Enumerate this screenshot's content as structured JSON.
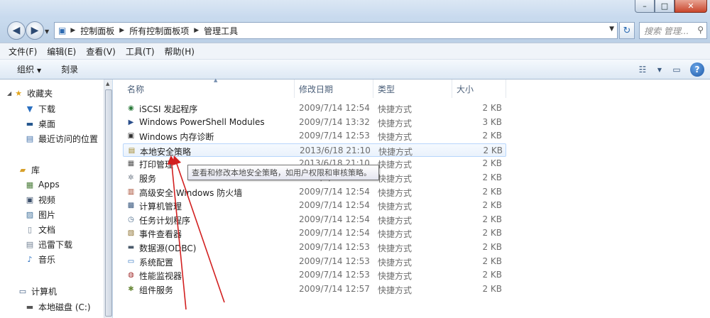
{
  "window": {
    "min_glyph": "–",
    "max_glyph": "□",
    "close_glyph": "✕"
  },
  "address": {
    "segments": [
      "控制面板",
      "所有控制面板项",
      "管理工具"
    ],
    "search_placeholder": "搜索 管理..."
  },
  "menu": [
    "文件(F)",
    "编辑(E)",
    "查看(V)",
    "工具(T)",
    "帮助(H)"
  ],
  "commands": {
    "organize": "组织",
    "burn": "刻录"
  },
  "sidebar": {
    "favorites": {
      "label": "收藏夹",
      "items": [
        "下载",
        "桌面",
        "最近访问的位置"
      ]
    },
    "libraries": {
      "label": "库",
      "items": [
        "Apps",
        "视频",
        "图片",
        "文档",
        "迅雷下载",
        "音乐"
      ]
    },
    "computer": {
      "label": "计算机",
      "items": [
        "本地磁盘 (C:)"
      ]
    }
  },
  "columns": {
    "name": "名称",
    "date": "修改日期",
    "type": "类型",
    "size": "大小"
  },
  "files": [
    {
      "name": "iSCSI 发起程序",
      "date": "2009/7/14 12:54",
      "type": "快捷方式",
      "size": "2 KB",
      "icon": "iscsi-icon"
    },
    {
      "name": "Windows PowerShell Modules",
      "date": "2009/7/14 13:32",
      "type": "快捷方式",
      "size": "3 KB",
      "icon": "powershell-icon"
    },
    {
      "name": "Windows 内存诊断",
      "date": "2009/7/14 12:53",
      "type": "快捷方式",
      "size": "2 KB",
      "icon": "memory-diagnostic-icon"
    },
    {
      "name": "本地安全策略",
      "date": "2013/6/18 21:10",
      "type": "快捷方式",
      "size": "2 KB",
      "icon": "security-policy-icon"
    },
    {
      "name": "打印管理",
      "date": "2013/6/18 21:10",
      "type": "快捷方式",
      "size": "2 KB",
      "icon": "print-management-icon"
    },
    {
      "name": "服务",
      "date": "2009/7/14 12:54",
      "type": "快捷方式",
      "size": "2 KB",
      "icon": "services-icon"
    },
    {
      "name": "高级安全 Windows 防火墙",
      "date": "2009/7/14 12:54",
      "type": "快捷方式",
      "size": "2 KB",
      "icon": "firewall-icon"
    },
    {
      "name": "计算机管理",
      "date": "2009/7/14 12:54",
      "type": "快捷方式",
      "size": "2 KB",
      "icon": "computer-management-icon"
    },
    {
      "name": "任务计划程序",
      "date": "2009/7/14 12:54",
      "type": "快捷方式",
      "size": "2 KB",
      "icon": "task-scheduler-icon"
    },
    {
      "name": "事件查看器",
      "date": "2009/7/14 12:54",
      "type": "快捷方式",
      "size": "2 KB",
      "icon": "event-viewer-icon"
    },
    {
      "name": "数据源(ODBC)",
      "date": "2009/7/14 12:53",
      "type": "快捷方式",
      "size": "2 KB",
      "icon": "odbc-icon"
    },
    {
      "name": "系统配置",
      "date": "2009/7/14 12:53",
      "type": "快捷方式",
      "size": "2 KB",
      "icon": "system-config-icon"
    },
    {
      "name": "性能监视器",
      "date": "2009/7/14 12:53",
      "type": "快捷方式",
      "size": "2 KB",
      "icon": "performance-monitor-icon"
    },
    {
      "name": "组件服务",
      "date": "2009/7/14 12:57",
      "type": "快捷方式",
      "size": "2 KB",
      "icon": "component-services-icon"
    }
  ],
  "tooltip": "查看和修改本地安全策略，如用户权限和审核策略。",
  "colors": {
    "annotation_arrow": "#d22020",
    "hover_border": "#b8d6fb"
  }
}
